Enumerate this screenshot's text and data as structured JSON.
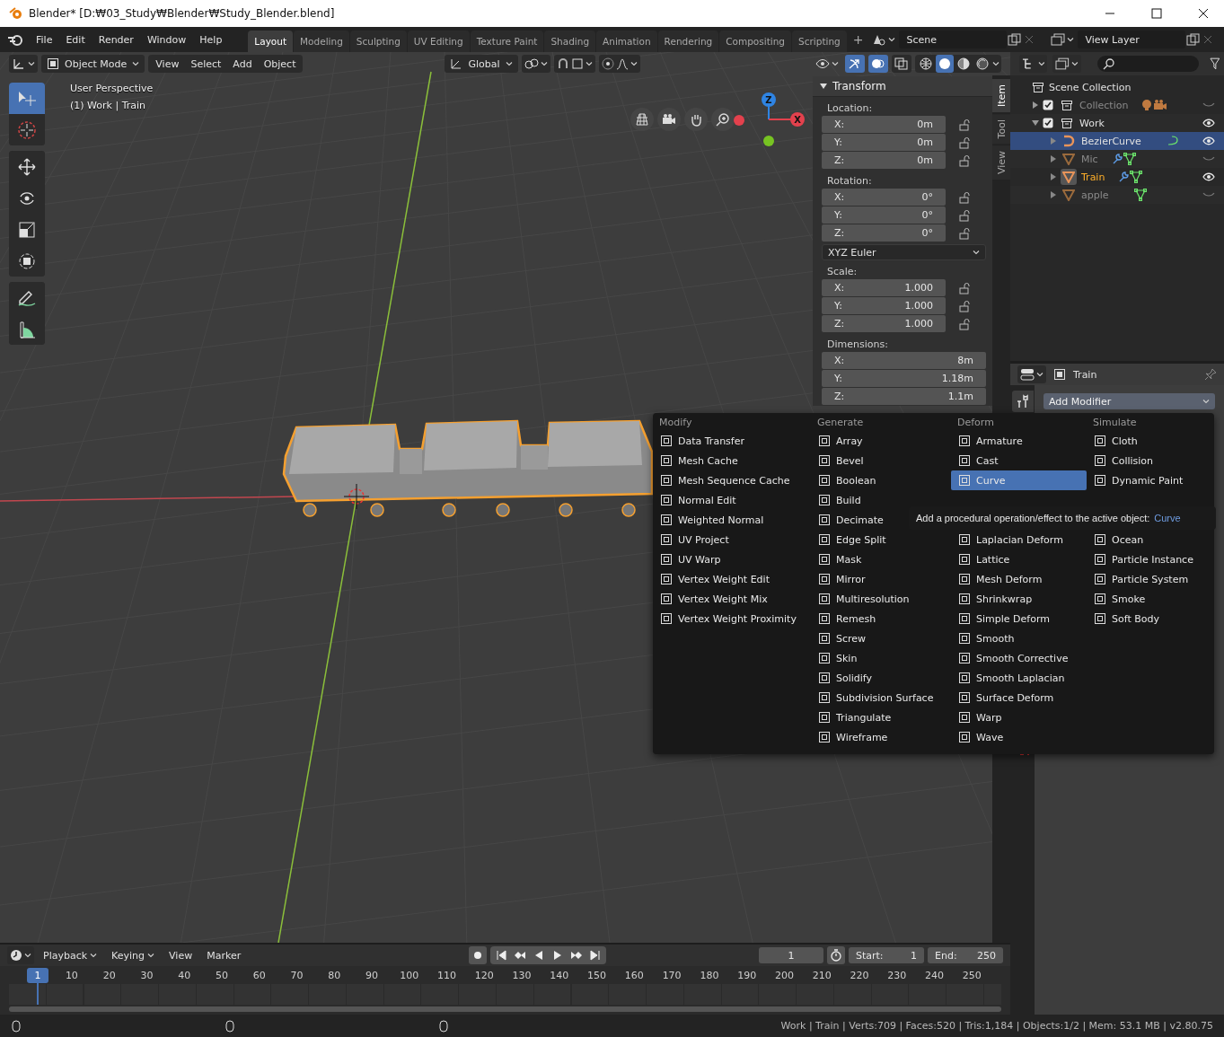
{
  "window": {
    "title": "Blender* [D:₩03_Study₩Blender₩Study_Blender.blend]"
  },
  "menubar": [
    "File",
    "Edit",
    "Render",
    "Window",
    "Help"
  ],
  "workspaces": [
    {
      "label": "Layout",
      "selected": true
    },
    {
      "label": "Modeling",
      "selected": false
    },
    {
      "label": "Sculpting",
      "selected": false
    },
    {
      "label": "UV Editing",
      "selected": false
    },
    {
      "label": "Texture Paint",
      "selected": false
    },
    {
      "label": "Shading",
      "selected": false
    },
    {
      "label": "Animation",
      "selected": false
    },
    {
      "label": "Rendering",
      "selected": false
    },
    {
      "label": "Compositing",
      "selected": false
    },
    {
      "label": "Scripting",
      "selected": false
    }
  ],
  "add_workspace": "+",
  "scene": "Scene",
  "view_layer": "View Layer",
  "viewport": {
    "mode": "Object Mode",
    "menus": [
      "View",
      "Select",
      "Add",
      "Object"
    ],
    "orientation": "Global",
    "toggles": [
      {
        "kind": "gizmo",
        "on": true
      },
      {
        "kind": "overlay",
        "on": true
      },
      {
        "kind": "xray",
        "on": false
      }
    ],
    "shading": [
      {
        "kind": "wireframe",
        "selected": false
      },
      {
        "kind": "solid",
        "selected": true
      },
      {
        "kind": "material",
        "selected": false
      },
      {
        "kind": "rendered",
        "selected": false
      }
    ],
    "info": [
      "User Perspective",
      "(1) Work | Train"
    ],
    "tools": [
      {
        "kind": "select",
        "selected": true
      },
      {
        "kind": "cursor",
        "selected": false
      },
      {
        "kind": "move",
        "selected": false
      },
      {
        "kind": "rotate",
        "selected": false
      },
      {
        "kind": "scale",
        "selected": false
      },
      {
        "kind": "transform",
        "selected": false
      },
      {
        "kind": "annotate",
        "selected": false
      },
      {
        "kind": "measure",
        "selected": false
      }
    ],
    "gizmo_labels": [
      "Z",
      "X"
    ]
  },
  "sidebar": {
    "tabs": [
      {
        "label": "Item",
        "selected": true
      },
      {
        "label": "Tool",
        "selected": false
      },
      {
        "label": "View",
        "selected": false
      }
    ],
    "panel": {
      "title": "Transform",
      "expanded": true,
      "groups": [
        {
          "label": "Location:",
          "fields": [
            {
              "axis": "X:",
              "value": "0m",
              "locked": false
            },
            {
              "axis": "Y:",
              "value": "0m",
              "locked": false
            },
            {
              "axis": "Z:",
              "value": "0m",
              "locked": false
            }
          ]
        },
        {
          "label": "Rotation:",
          "fields": [
            {
              "axis": "X:",
              "value": "0°",
              "locked": false
            },
            {
              "axis": "Y:",
              "value": "0°",
              "locked": false
            },
            {
              "axis": "Z:",
              "value": "0°",
              "locked": false
            }
          ],
          "mode": "XYZ Euler"
        },
        {
          "label": "Scale:",
          "fields": [
            {
              "axis": "X:",
              "value": "1.000",
              "locked": false
            },
            {
              "axis": "Y:",
              "value": "1.000",
              "locked": false
            },
            {
              "axis": "Z:",
              "value": "1.000",
              "locked": false
            }
          ]
        },
        {
          "label": "Dimensions:",
          "fields": [
            {
              "axis": "X:",
              "value": "8m"
            },
            {
              "axis": "Y:",
              "value": "1.18m"
            },
            {
              "axis": "Z:",
              "value": "1.1m"
            }
          ]
        }
      ]
    }
  },
  "outliner": {
    "root": "Scene Collection",
    "items": [
      {
        "label": "Collection",
        "kind": "collection",
        "expanded": false,
        "checked": true,
        "visible": false,
        "selected": false,
        "active": false,
        "has_lights": true,
        "has_cameras": true
      },
      {
        "label": "Work",
        "kind": "collection",
        "expanded": true,
        "checked": true,
        "visible": true,
        "selected": false,
        "active": false,
        "children": [
          {
            "label": "BezierCurve",
            "kind": "curve",
            "expanded": false,
            "visible": true,
            "selected": true,
            "active": false,
            "modifiers": false
          },
          {
            "label": "Mic",
            "kind": "mesh",
            "expanded": false,
            "visible": false,
            "selected": false,
            "active": false,
            "modifiers": true
          },
          {
            "label": "Train",
            "kind": "mesh",
            "expanded": false,
            "visible": true,
            "selected": false,
            "active": true,
            "modifiers": true
          },
          {
            "label": "apple",
            "kind": "mesh",
            "expanded": false,
            "visible": false,
            "selected": false,
            "active": false,
            "modifiers": false
          }
        ]
      }
    ]
  },
  "properties": {
    "object": "Train",
    "add_modifier": "Add Modifier"
  },
  "modifier_menu": {
    "columns": [
      {
        "heading": "Modify",
        "items": [
          {
            "label": "Data Transfer",
            "selected": false
          },
          {
            "label": "Mesh Cache",
            "selected": false
          },
          {
            "label": "Mesh Sequence Cache",
            "selected": false
          },
          {
            "label": "Normal Edit",
            "selected": false
          },
          {
            "label": "Weighted Normal",
            "selected": false
          },
          {
            "label": "UV Project",
            "selected": false
          },
          {
            "label": "UV Warp",
            "selected": false
          },
          {
            "label": "Vertex Weight Edit",
            "selected": false
          },
          {
            "label": "Vertex Weight Mix",
            "selected": false
          },
          {
            "label": "Vertex Weight Proximity",
            "selected": false
          }
        ]
      },
      {
        "heading": "Generate",
        "items": [
          {
            "label": "Array",
            "selected": false
          },
          {
            "label": "Bevel",
            "selected": false
          },
          {
            "label": "Boolean",
            "selected": false
          },
          {
            "label": "Build",
            "selected": false
          },
          {
            "label": "Decimate",
            "selected": false
          },
          {
            "label": "Edge Split",
            "selected": false
          },
          {
            "label": "Mask",
            "selected": false
          },
          {
            "label": "Mirror",
            "selected": false
          },
          {
            "label": "Multiresolution",
            "selected": false
          },
          {
            "label": "Remesh",
            "selected": false
          },
          {
            "label": "Screw",
            "selected": false
          },
          {
            "label": "Skin",
            "selected": false
          },
          {
            "label": "Solidify",
            "selected": false
          },
          {
            "label": "Subdivision Surface",
            "selected": false
          },
          {
            "label": "Triangulate",
            "selected": false
          },
          {
            "label": "Wireframe",
            "selected": false
          }
        ]
      },
      {
        "heading": "Deform",
        "items": [
          {
            "label": "Armature",
            "selected": false
          },
          {
            "label": "Cast",
            "selected": false
          },
          {
            "label": "Curve",
            "selected": true
          },
          {
            "label": "Laplacian Deform",
            "selected": false,
            "after_tooltip": true
          },
          {
            "label": "Lattice",
            "selected": false
          },
          {
            "label": "Mesh Deform",
            "selected": false
          },
          {
            "label": "Shrinkwrap",
            "selected": false
          },
          {
            "label": "Simple Deform",
            "selected": false
          },
          {
            "label": "Smooth",
            "selected": false
          },
          {
            "label": "Smooth Corrective",
            "selected": false
          },
          {
            "label": "Smooth Laplacian",
            "selected": false
          },
          {
            "label": "Surface Deform",
            "selected": false
          },
          {
            "label": "Warp",
            "selected": false
          },
          {
            "label": "Wave",
            "selected": false
          }
        ]
      },
      {
        "heading": "Simulate",
        "items": [
          {
            "label": "Cloth",
            "selected": false
          },
          {
            "label": "Collision",
            "selected": false
          },
          {
            "label": "Dynamic Paint",
            "selected": false
          },
          {
            "label": "Ocean",
            "selected": false,
            "after_tooltip": true
          },
          {
            "label": "Particle Instance",
            "selected": false
          },
          {
            "label": "Particle System",
            "selected": false
          },
          {
            "label": "Smoke",
            "selected": false
          },
          {
            "label": "Soft Body",
            "selected": false
          }
        ]
      }
    ],
    "tooltip": {
      "text": "Add a procedural operation/effect to the active object:",
      "value": "Curve"
    }
  },
  "timeline": {
    "menus": [
      {
        "label": "Playback",
        "dropdown": true
      },
      {
        "label": "Keying",
        "dropdown": true
      },
      {
        "label": "View",
        "dropdown": false
      },
      {
        "label": "Marker",
        "dropdown": false
      }
    ],
    "current_frame": "1",
    "start_label": "Start:",
    "start": "1",
    "end_label": "End:",
    "end": "250",
    "playhead": "1",
    "ticks": [
      "10",
      "20",
      "30",
      "40",
      "50",
      "60",
      "70",
      "80",
      "90",
      "100",
      "110",
      "120",
      "130",
      "140",
      "150",
      "160",
      "170",
      "180",
      "190",
      "200",
      "210",
      "220",
      "230",
      "240",
      "250"
    ]
  },
  "status_bar": "Work | Train | Verts:709 | Faces:520 | Tris:1,184 | Objects:1/2 | Mem: 53.1 MB | v2.80.75"
}
